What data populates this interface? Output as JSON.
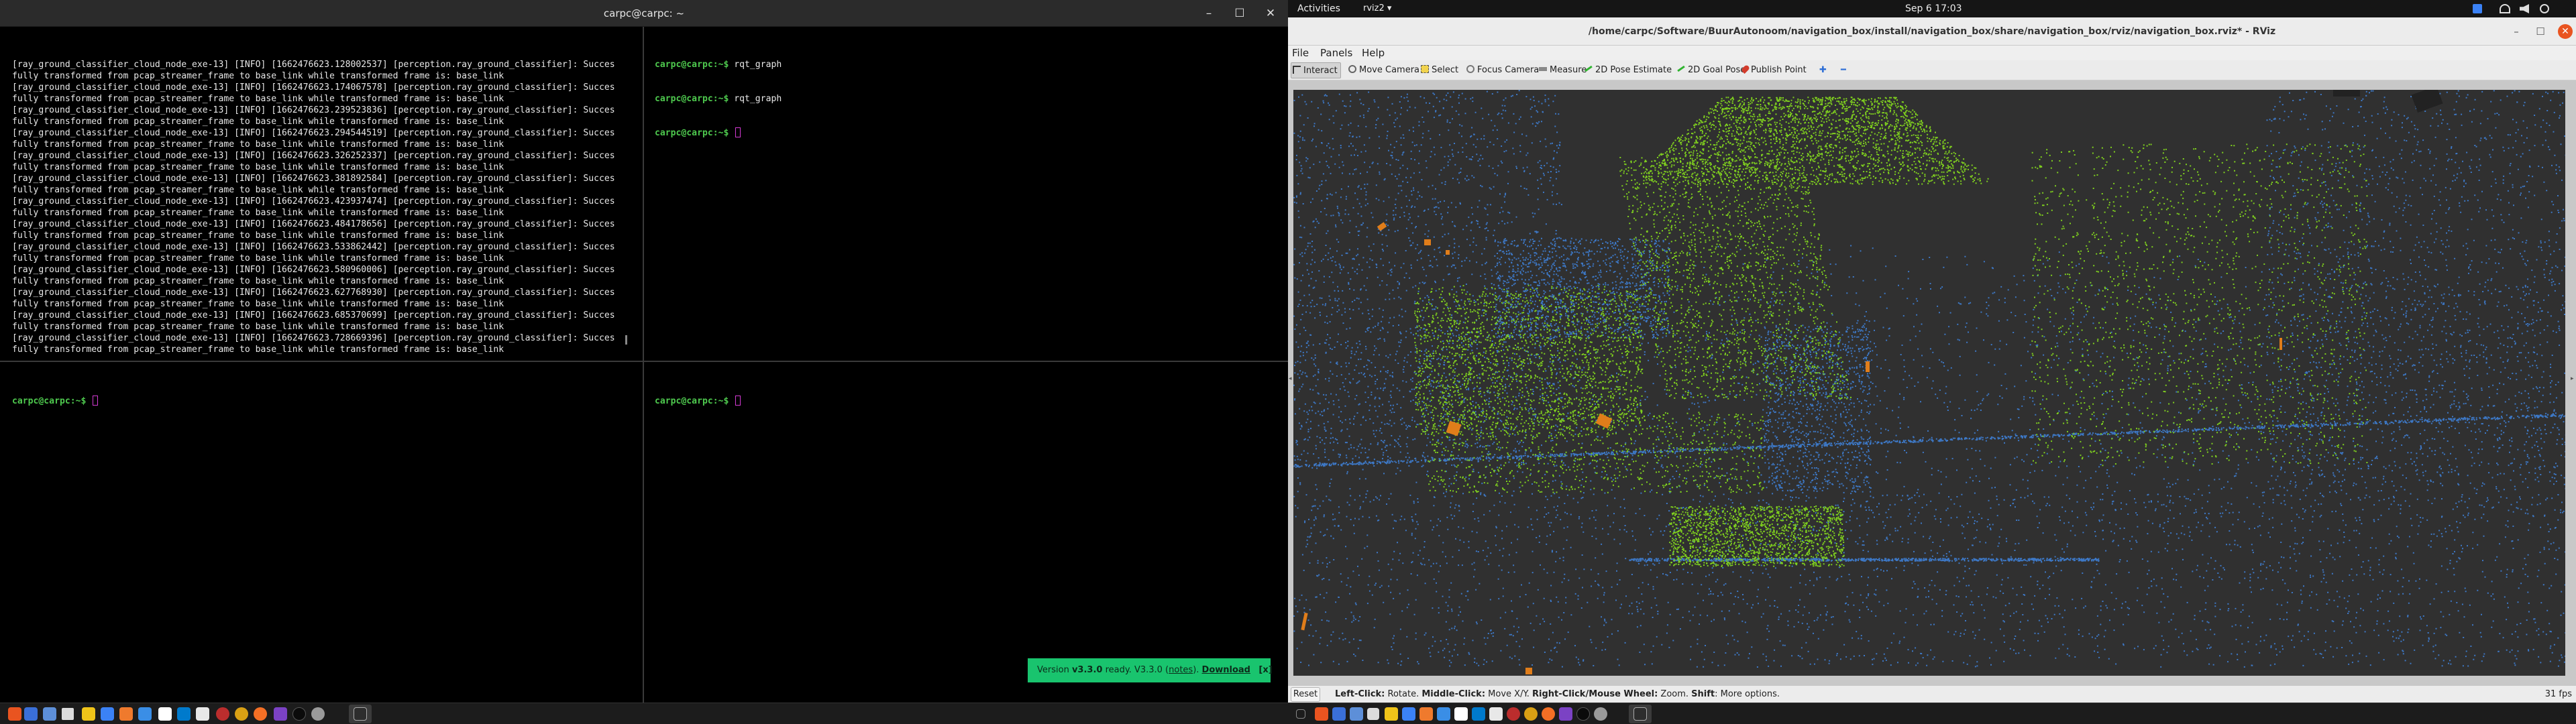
{
  "terminal": {
    "title": "carpc@carpc: ~",
    "controls": {
      "minimize": "–",
      "maximize": "☐",
      "close": "✕"
    },
    "pane_top_left": {
      "lines": [
        "[ray_ground_classifier_cloud_node_exe-13] [INFO] [1662476623.128002537] [perception.ray_ground_classifier]: Succes",
        "fully transformed from pcap_streamer_frame to base_link while transformed frame is: base_link",
        "[ray_ground_classifier_cloud_node_exe-13] [INFO] [1662476623.174067578] [perception.ray_ground_classifier]: Succes",
        "fully transformed from pcap_streamer_frame to base_link while transformed frame is: base_link",
        "[ray_ground_classifier_cloud_node_exe-13] [INFO] [1662476623.239523836] [perception.ray_ground_classifier]: Succes",
        "fully transformed from pcap_streamer_frame to base_link while transformed frame is: base_link",
        "[ray_ground_classifier_cloud_node_exe-13] [INFO] [1662476623.294544519] [perception.ray_ground_classifier]: Succes",
        "fully transformed from pcap_streamer_frame to base_link while transformed frame is: base_link",
        "[ray_ground_classifier_cloud_node_exe-13] [INFO] [1662476623.326252337] [perception.ray_ground_classifier]: Succes",
        "fully transformed from pcap_streamer_frame to base_link while transformed frame is: base_link",
        "[ray_ground_classifier_cloud_node_exe-13] [INFO] [1662476623.381892584] [perception.ray_ground_classifier]: Succes",
        "fully transformed from pcap_streamer_frame to base_link while transformed frame is: base_link",
        "[ray_ground_classifier_cloud_node_exe-13] [INFO] [1662476623.423937474] [perception.ray_ground_classifier]: Succes",
        "fully transformed from pcap_streamer_frame to base_link while transformed frame is: base_link",
        "[ray_ground_classifier_cloud_node_exe-13] [INFO] [1662476623.484178656] [perception.ray_ground_classifier]: Succes",
        "fully transformed from pcap_streamer_frame to base_link while transformed frame is: base_link",
        "[ray_ground_classifier_cloud_node_exe-13] [INFO] [1662476623.533862442] [perception.ray_ground_classifier]: Succes",
        "fully transformed from pcap_streamer_frame to base_link while transformed frame is: base_link",
        "[ray_ground_classifier_cloud_node_exe-13] [INFO] [1662476623.580960006] [perception.ray_ground_classifier]: Succes",
        "fully transformed from pcap_streamer_frame to base_link while transformed frame is: base_link",
        "[ray_ground_classifier_cloud_node_exe-13] [INFO] [1662476623.627768930] [perception.ray_ground_classifier]: Succes",
        "fully transformed from pcap_streamer_frame to base_link while transformed frame is: base_link",
        "[ray_ground_classifier_cloud_node_exe-13] [INFO] [1662476623.685370699] [perception.ray_ground_classifier]: Succes",
        "fully transformed from pcap_streamer_frame to base_link while transformed frame is: base_link",
        "[ray_ground_classifier_cloud_node_exe-13] [INFO] [1662476623.728669396] [perception.ray_ground_classifier]: Succes",
        "fully transformed from pcap_streamer_frame to base_link while transformed frame is: base_link"
      ]
    },
    "pane_top_right": {
      "prompt": "carpc@carpc:~$",
      "commands": [
        "rqt_graph",
        "rqt_graph",
        ""
      ]
    },
    "pane_bottom_left": {
      "prompt": "carpc@carpc:~$"
    },
    "pane_bottom_right": {
      "prompt": "carpc@carpc:~$"
    },
    "update_banner": {
      "prefix": "Version ",
      "version": "v3.3.0",
      "middle": " ready. V3.3.0 (",
      "notes": "notes",
      "suffix": "). ",
      "download": "Download",
      "close": "[x]"
    }
  },
  "gnome_bar": {
    "activities": "Activities",
    "app_menu": "rviz2 ▾",
    "clock": "Sep 6  17:03",
    "tray_icons": [
      "dropbox-icon",
      "network-icon",
      "volume-icon",
      "power-icon"
    ]
  },
  "rviz": {
    "title": "/home/carpc/Software/BuurAutonoom/navigation_box/install/navigation_box/share/navigation_box/rviz/navigation_box.rviz* - RViz",
    "menu": [
      "File",
      "Panels",
      "Help"
    ],
    "tools": [
      {
        "label": "Interact",
        "icon": "cursor-icon",
        "selected": true
      },
      {
        "label": "Move Camera",
        "icon": "camera-icon",
        "selected": false
      },
      {
        "label": "Select",
        "icon": "select-icon",
        "selected": false
      },
      {
        "label": "Focus Camera",
        "icon": "focus-icon",
        "selected": false
      },
      {
        "label": "Measure",
        "icon": "ruler-icon",
        "selected": false
      },
      {
        "label": "2D Pose Estimate",
        "icon": "pose-arrow-icon",
        "selected": false
      },
      {
        "label": "2D Goal Pose",
        "icon": "goal-arrow-icon",
        "selected": false
      },
      {
        "label": "Publish Point",
        "icon": "pin-icon",
        "selected": false
      }
    ],
    "status": {
      "reset": "Reset",
      "b1": "Left-Click:",
      "t1": " Rotate. ",
      "b2": "Middle-Click:",
      "t2": " Move X/Y. ",
      "b3": "Right-Click/Mouse Wheel:",
      "t3": " Zoom. ",
      "b4": "Shift",
      "t4": ": More options.",
      "fps": "31 fps"
    },
    "colors": {
      "ground_points": "#7fd01e",
      "obstacle_points": "#3d78c6",
      "boxes": "#e07d1a",
      "background": "#303030"
    }
  }
}
